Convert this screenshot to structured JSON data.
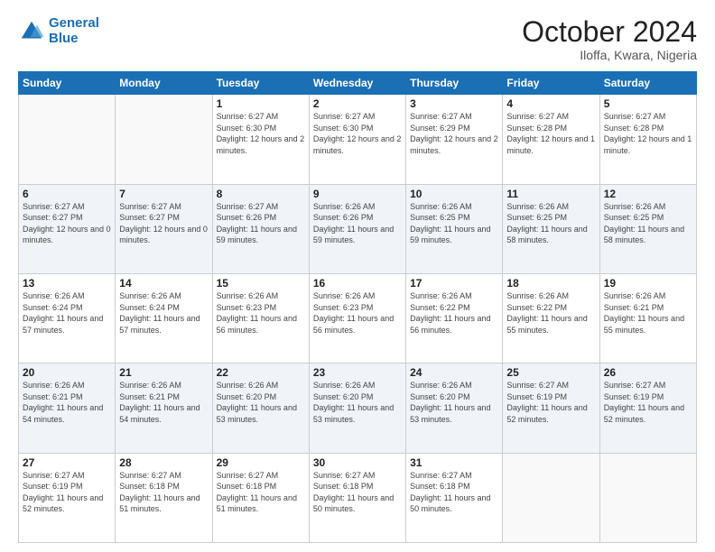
{
  "logo": {
    "text_general": "General",
    "text_blue": "Blue"
  },
  "header": {
    "month": "October 2024",
    "location": "Iloffa, Kwara, Nigeria"
  },
  "days_of_week": [
    "Sunday",
    "Monday",
    "Tuesday",
    "Wednesday",
    "Thursday",
    "Friday",
    "Saturday"
  ],
  "weeks": [
    [
      {
        "day": "",
        "sunrise": "",
        "sunset": "",
        "daylight": ""
      },
      {
        "day": "",
        "sunrise": "",
        "sunset": "",
        "daylight": ""
      },
      {
        "day": "1",
        "sunrise": "Sunrise: 6:27 AM",
        "sunset": "Sunset: 6:30 PM",
        "daylight": "Daylight: 12 hours and 2 minutes."
      },
      {
        "day": "2",
        "sunrise": "Sunrise: 6:27 AM",
        "sunset": "Sunset: 6:30 PM",
        "daylight": "Daylight: 12 hours and 2 minutes."
      },
      {
        "day": "3",
        "sunrise": "Sunrise: 6:27 AM",
        "sunset": "Sunset: 6:29 PM",
        "daylight": "Daylight: 12 hours and 2 minutes."
      },
      {
        "day": "4",
        "sunrise": "Sunrise: 6:27 AM",
        "sunset": "Sunset: 6:28 PM",
        "daylight": "Daylight: 12 hours and 1 minute."
      },
      {
        "day": "5",
        "sunrise": "Sunrise: 6:27 AM",
        "sunset": "Sunset: 6:28 PM",
        "daylight": "Daylight: 12 hours and 1 minute."
      }
    ],
    [
      {
        "day": "6",
        "sunrise": "Sunrise: 6:27 AM",
        "sunset": "Sunset: 6:27 PM",
        "daylight": "Daylight: 12 hours and 0 minutes."
      },
      {
        "day": "7",
        "sunrise": "Sunrise: 6:27 AM",
        "sunset": "Sunset: 6:27 PM",
        "daylight": "Daylight: 12 hours and 0 minutes."
      },
      {
        "day": "8",
        "sunrise": "Sunrise: 6:27 AM",
        "sunset": "Sunset: 6:26 PM",
        "daylight": "Daylight: 11 hours and 59 minutes."
      },
      {
        "day": "9",
        "sunrise": "Sunrise: 6:26 AM",
        "sunset": "Sunset: 6:26 PM",
        "daylight": "Daylight: 11 hours and 59 minutes."
      },
      {
        "day": "10",
        "sunrise": "Sunrise: 6:26 AM",
        "sunset": "Sunset: 6:25 PM",
        "daylight": "Daylight: 11 hours and 59 minutes."
      },
      {
        "day": "11",
        "sunrise": "Sunrise: 6:26 AM",
        "sunset": "Sunset: 6:25 PM",
        "daylight": "Daylight: 11 hours and 58 minutes."
      },
      {
        "day": "12",
        "sunrise": "Sunrise: 6:26 AM",
        "sunset": "Sunset: 6:25 PM",
        "daylight": "Daylight: 11 hours and 58 minutes."
      }
    ],
    [
      {
        "day": "13",
        "sunrise": "Sunrise: 6:26 AM",
        "sunset": "Sunset: 6:24 PM",
        "daylight": "Daylight: 11 hours and 57 minutes."
      },
      {
        "day": "14",
        "sunrise": "Sunrise: 6:26 AM",
        "sunset": "Sunset: 6:24 PM",
        "daylight": "Daylight: 11 hours and 57 minutes."
      },
      {
        "day": "15",
        "sunrise": "Sunrise: 6:26 AM",
        "sunset": "Sunset: 6:23 PM",
        "daylight": "Daylight: 11 hours and 56 minutes."
      },
      {
        "day": "16",
        "sunrise": "Sunrise: 6:26 AM",
        "sunset": "Sunset: 6:23 PM",
        "daylight": "Daylight: 11 hours and 56 minutes."
      },
      {
        "day": "17",
        "sunrise": "Sunrise: 6:26 AM",
        "sunset": "Sunset: 6:22 PM",
        "daylight": "Daylight: 11 hours and 56 minutes."
      },
      {
        "day": "18",
        "sunrise": "Sunrise: 6:26 AM",
        "sunset": "Sunset: 6:22 PM",
        "daylight": "Daylight: 11 hours and 55 minutes."
      },
      {
        "day": "19",
        "sunrise": "Sunrise: 6:26 AM",
        "sunset": "Sunset: 6:21 PM",
        "daylight": "Daylight: 11 hours and 55 minutes."
      }
    ],
    [
      {
        "day": "20",
        "sunrise": "Sunrise: 6:26 AM",
        "sunset": "Sunset: 6:21 PM",
        "daylight": "Daylight: 11 hours and 54 minutes."
      },
      {
        "day": "21",
        "sunrise": "Sunrise: 6:26 AM",
        "sunset": "Sunset: 6:21 PM",
        "daylight": "Daylight: 11 hours and 54 minutes."
      },
      {
        "day": "22",
        "sunrise": "Sunrise: 6:26 AM",
        "sunset": "Sunset: 6:20 PM",
        "daylight": "Daylight: 11 hours and 53 minutes."
      },
      {
        "day": "23",
        "sunrise": "Sunrise: 6:26 AM",
        "sunset": "Sunset: 6:20 PM",
        "daylight": "Daylight: 11 hours and 53 minutes."
      },
      {
        "day": "24",
        "sunrise": "Sunrise: 6:26 AM",
        "sunset": "Sunset: 6:20 PM",
        "daylight": "Daylight: 11 hours and 53 minutes."
      },
      {
        "day": "25",
        "sunrise": "Sunrise: 6:27 AM",
        "sunset": "Sunset: 6:19 PM",
        "daylight": "Daylight: 11 hours and 52 minutes."
      },
      {
        "day": "26",
        "sunrise": "Sunrise: 6:27 AM",
        "sunset": "Sunset: 6:19 PM",
        "daylight": "Daylight: 11 hours and 52 minutes."
      }
    ],
    [
      {
        "day": "27",
        "sunrise": "Sunrise: 6:27 AM",
        "sunset": "Sunset: 6:19 PM",
        "daylight": "Daylight: 11 hours and 52 minutes."
      },
      {
        "day": "28",
        "sunrise": "Sunrise: 6:27 AM",
        "sunset": "Sunset: 6:18 PM",
        "daylight": "Daylight: 11 hours and 51 minutes."
      },
      {
        "day": "29",
        "sunrise": "Sunrise: 6:27 AM",
        "sunset": "Sunset: 6:18 PM",
        "daylight": "Daylight: 11 hours and 51 minutes."
      },
      {
        "day": "30",
        "sunrise": "Sunrise: 6:27 AM",
        "sunset": "Sunset: 6:18 PM",
        "daylight": "Daylight: 11 hours and 50 minutes."
      },
      {
        "day": "31",
        "sunrise": "Sunrise: 6:27 AM",
        "sunset": "Sunset: 6:18 PM",
        "daylight": "Daylight: 11 hours and 50 minutes."
      },
      {
        "day": "",
        "sunrise": "",
        "sunset": "",
        "daylight": ""
      },
      {
        "day": "",
        "sunrise": "",
        "sunset": "",
        "daylight": ""
      }
    ]
  ]
}
